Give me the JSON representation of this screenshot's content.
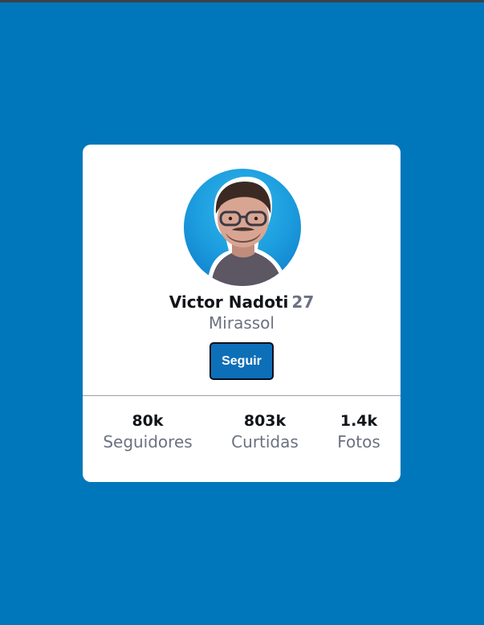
{
  "profile": {
    "name": "Victor Nadoti",
    "age": "27",
    "city": "Mirassol",
    "follow_label": "Seguir"
  },
  "stats": [
    {
      "value": "80k",
      "label": "Seguidores"
    },
    {
      "value": "803k",
      "label": "Curtidas"
    },
    {
      "value": "1.4k",
      "label": "Fotos"
    }
  ],
  "colors": {
    "background": "#0077ba",
    "button": "#0c6fb8",
    "muted_text": "#6b7181"
  }
}
